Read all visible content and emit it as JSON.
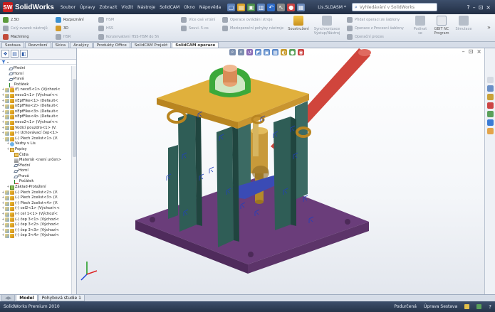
{
  "app": {
    "logo_text": "SolidWorks",
    "menu": [
      "Soubor",
      "Úpravy",
      "Zobrazit",
      "Vložit",
      "Nástroje",
      "SolidCAM",
      "Okno",
      "Nápověda"
    ],
    "document_title": "Lis.SLDASM *",
    "search_placeholder": "Vyhledávání v SolidWorks",
    "window_controls": [
      "?",
      "–",
      "⊡",
      "×"
    ]
  },
  "ribbon": {
    "col1": [
      "2.5D",
      "Celý svazek nástrojů",
      "Machining"
    ],
    "col2": [
      "Rozpoznání",
      "3D",
      "HSR"
    ],
    "col3": [
      "HSM",
      "HSS",
      "Konzervativní HSS-HSM do 5h"
    ],
    "col4": [
      "Více osé vrtání",
      "Souvi. 5-os",
      "Konzervativní HSS-HSM do 5h-os"
    ],
    "col5": [
      "Operace ovládání stroje",
      "Mezioperační pohyby nástroje"
    ],
    "big1": "Soustružení",
    "big2": "Synchronizace Výstup/Nástroj",
    "col6": [
      "Přidat operaci ze šablony",
      "Operace z Procesní šablony",
      "Operační proces"
    ],
    "big3": "Podívat se",
    "big4": "GBIT NC Program",
    "big5": "Simulace"
  },
  "tabs": [
    "Sestava",
    "Rozvržení",
    "Skica",
    "Analýzy",
    "Produkty Office",
    "SolidCAM Projekt",
    "SolidCAM operace"
  ],
  "active_tab": "SolidCAM operace",
  "tree": [
    {
      "label": "Přední",
      "icon": "plane",
      "expand": "",
      "indent": 8
    },
    {
      "label": "Horní",
      "icon": "plane",
      "expand": "",
      "indent": 8
    },
    {
      "label": "Pravá",
      "icon": "plane",
      "expand": "",
      "indent": 8
    },
    {
      "label": "Počátek",
      "icon": "origin",
      "expand": "",
      "indent": 8
    },
    {
      "label": "(f) neco5<1> (Výchozí<",
      "icon": "part",
      "expand": "+",
      "indent": 2
    },
    {
      "label": "neco1<1> (Výchozí<<",
      "icon": "part",
      "expand": "+",
      "indent": 2
    },
    {
      "label": "nEpfFike<1> (Default<",
      "icon": "part",
      "expand": "+",
      "indent": 2
    },
    {
      "label": "nEpfFike<2> (Default<",
      "icon": "part",
      "expand": "+",
      "indent": 2
    },
    {
      "label": "nEpfFike<3> (Default<",
      "icon": "part",
      "expand": "+",
      "indent": 2
    },
    {
      "label": "nEpfFike<4> (Default<",
      "icon": "part",
      "expand": "+",
      "indent": 2
    },
    {
      "label": "neco2<1> (Výchozí<<",
      "icon": "part",
      "expand": "+",
      "indent": 2
    },
    {
      "label": "Vodicí pouzdro<1> (V.",
      "icon": "part",
      "expand": "+",
      "indent": 2
    },
    {
      "label": "(-) Uchovávací čep<1>",
      "icon": "part",
      "expand": "+",
      "indent": 2
    },
    {
      "label": "(-) Plech 2celist<1> (V.",
      "icon": "part",
      "expand": "-",
      "indent": 2
    },
    {
      "label": "Vazby v Lis",
      "icon": "mate",
      "expand": "+",
      "indent": 9
    },
    {
      "label": "Popisy",
      "icon": "folder",
      "expand": "+",
      "indent": 9
    },
    {
      "label": "Čidla",
      "icon": "folder",
      "expand": "",
      "indent": 15
    },
    {
      "label": "Materiál <není určen>",
      "icon": "mat",
      "expand": "",
      "indent": 15
    },
    {
      "label": "Přední",
      "icon": "plane",
      "expand": "",
      "indent": 15
    },
    {
      "label": "Horní",
      "icon": "plane",
      "expand": "",
      "indent": 15
    },
    {
      "label": "Pravá",
      "icon": "plane",
      "expand": "",
      "indent": 15
    },
    {
      "label": "Počátek",
      "icon": "origin",
      "expand": "",
      "indent": 15
    },
    {
      "label": "Základ-Protažení",
      "icon": "ext",
      "expand": "+",
      "indent": 9
    },
    {
      "label": "(-) Plech 2celist<2> (V.",
      "icon": "part",
      "expand": "+",
      "indent": 2
    },
    {
      "label": "(-) Plech 2celist<3> (V.",
      "icon": "part",
      "expand": "+",
      "indent": 2
    },
    {
      "label": "(-) Plech 2celist<4> (V.",
      "icon": "part",
      "expand": "+",
      "indent": 2
    },
    {
      "label": "(-) cel2<1> (Výchozí<<",
      "icon": "part",
      "expand": "+",
      "indent": 2
    },
    {
      "label": "(-) cel 1<1> (Výchozí<",
      "icon": "part",
      "expand": "+",
      "indent": 2
    },
    {
      "label": "(-) čep 3<1> (Výchozí<",
      "icon": "part",
      "expand": "+",
      "indent": 2
    },
    {
      "label": "(-) čep 3<2> (Výchozí<",
      "icon": "part",
      "expand": "+",
      "indent": 2
    },
    {
      "label": "(-) čep 3<3> (Výchozí<",
      "icon": "part",
      "expand": "+",
      "indent": 2
    },
    {
      "label": "(-) čep 3<4> (Výchozí<",
      "icon": "part",
      "expand": "+",
      "indent": 2
    }
  ],
  "bottom_tabs": [
    "Model",
    "Pohybová studie 1"
  ],
  "active_bottom_tab": "Model",
  "status": {
    "left": "SolidWorks Premium 2010",
    "right1": "Podurčená",
    "right2": "Úprava Sestava"
  },
  "colors": {
    "plate": "#6a3d7a",
    "top_plate": "#e0b03c",
    "columns": "#2f5d56",
    "rod": "#d0453c",
    "clamp": "#3ca93a",
    "lever": "#3a4bb5"
  }
}
